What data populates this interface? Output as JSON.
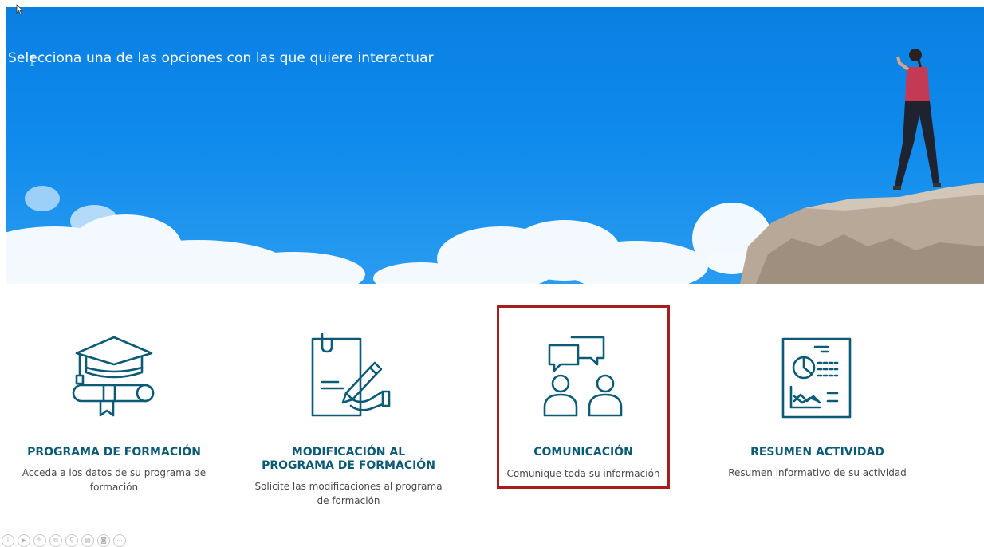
{
  "hero": {
    "prompt": "Selecciona una de las opciones con las que quiere interactuar"
  },
  "options": [
    {
      "title": "PROGRAMA DE FORMACIÓN",
      "description": "Acceda a los datos de su programa de formación",
      "icon": "graduation-cap-books-icon"
    },
    {
      "title": "MODIFICACIÓN AL PROGRAMA DE FORMACIÓN",
      "description": "Solicite las modificaciones al programa de formación",
      "icon": "document-signing-icon"
    },
    {
      "title": "COMUNICACIÓN",
      "description": "Comunique toda su información",
      "icon": "chat-users-icon",
      "selected": true
    },
    {
      "title": "RESUMEN ACTIVIDAD",
      "description": "Resumen informativo de su actividad",
      "icon": "report-chart-icon"
    }
  ],
  "colors": {
    "icon_teal": "#0b5a76",
    "selection_border": "#a51d1d",
    "sky": "#0e8aec"
  },
  "toolbar_icons": [
    "info-icon",
    "play-icon",
    "pen-icon",
    "copy-icon",
    "zoom-icon",
    "save-icon",
    "camera-icon",
    "more-icon"
  ]
}
